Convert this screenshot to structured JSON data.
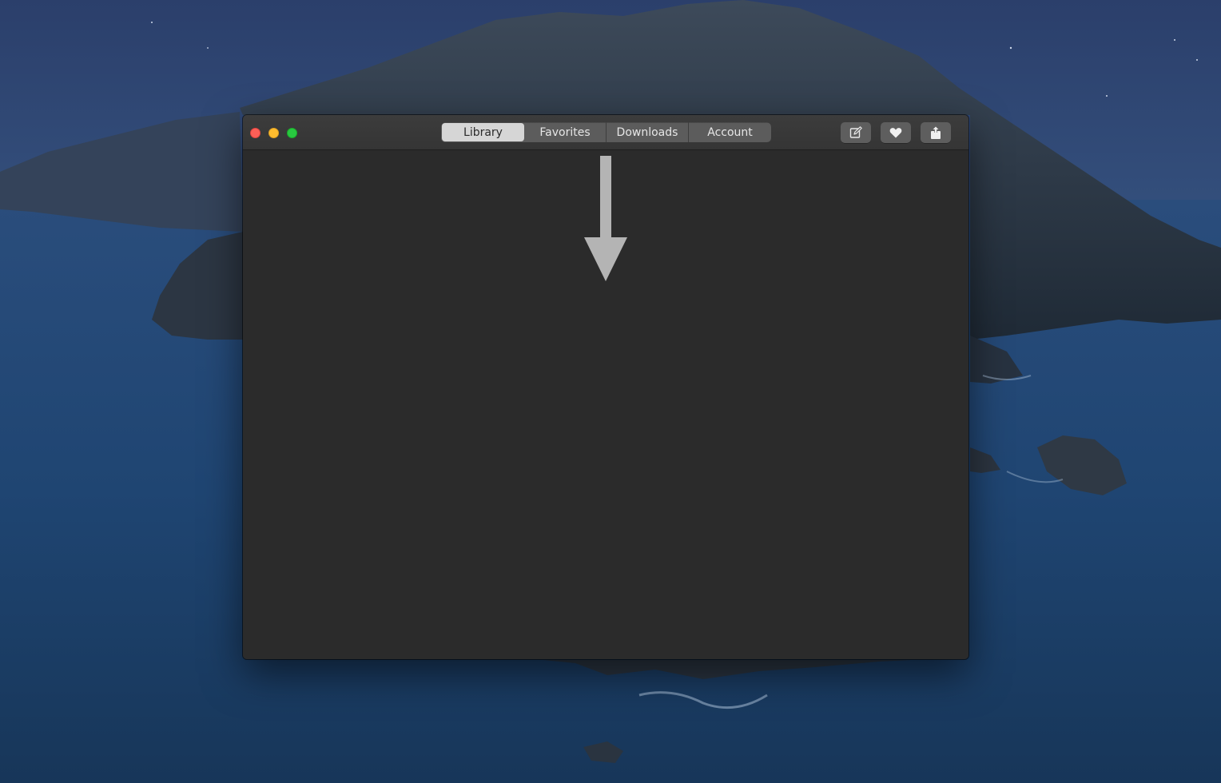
{
  "window": {
    "tabs": [
      {
        "label": "Library",
        "selected": true
      },
      {
        "label": "Favorites",
        "selected": false
      },
      {
        "label": "Downloads",
        "selected": false
      },
      {
        "label": "Account",
        "selected": false
      }
    ],
    "toolbar": {
      "buttons": [
        {
          "icon": "compose-icon"
        },
        {
          "icon": "heart-icon"
        },
        {
          "icon": "share-icon"
        }
      ]
    },
    "traffic_lights": {
      "close_color": "#fe5f57",
      "minimize_color": "#febc2e",
      "zoom_color": "#28c840"
    },
    "content": {
      "annotation_icon": "down-arrow-icon"
    }
  },
  "colors": {
    "window_background": "#2b2b2b",
    "titlebar": "#3a3a3a",
    "selected_segment": "#d6d6d6",
    "arrow": "#b4b4b4"
  }
}
